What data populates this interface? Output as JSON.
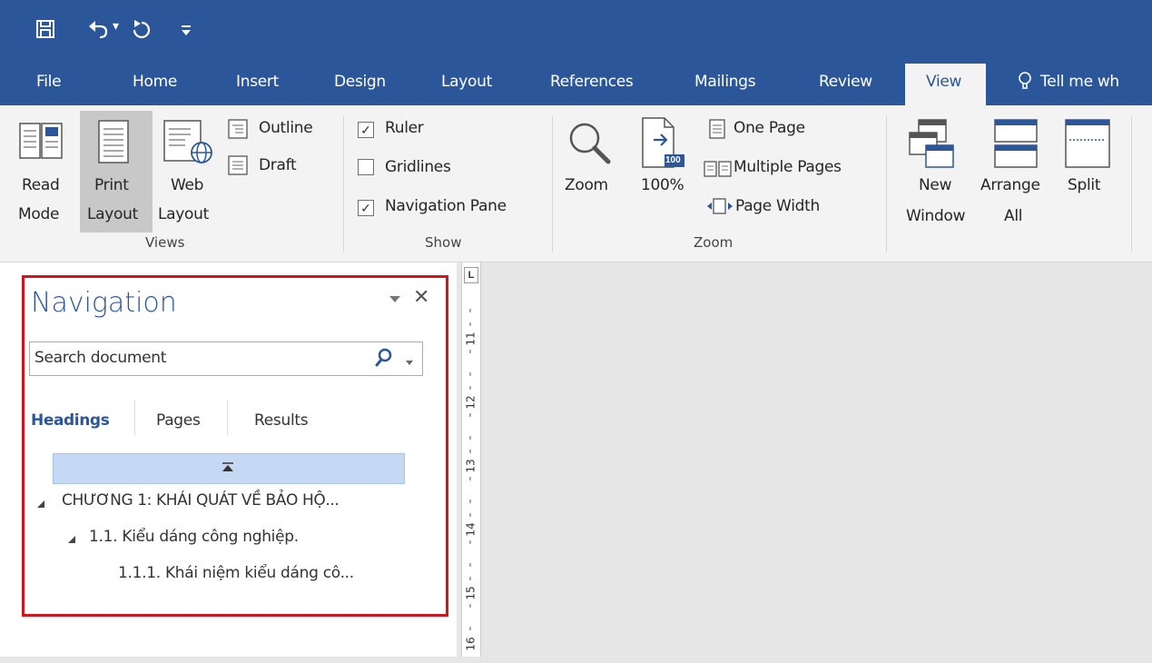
{
  "qat": {
    "save_icon": "floppy-disk",
    "undo_icon": "undo-arrow",
    "undo_dropdown": "▾",
    "repeat_icon": "repeat",
    "customize_icon": "customize"
  },
  "tabs": [
    "File",
    "Home",
    "Insert",
    "Design",
    "Layout",
    "References",
    "Mailings",
    "Review",
    "View"
  ],
  "tell_me": "Tell me wh",
  "ribbon": {
    "views": {
      "read_mode_1": "Read",
      "read_mode_2": "Mode",
      "print_layout_1": "Print",
      "print_layout_2": "Layout",
      "web_layout_1": "Web",
      "web_layout_2": "Layout",
      "outline": "Outline",
      "draft": "Draft",
      "group": "Views"
    },
    "show": {
      "ruler": "Ruler",
      "gridlines": "Gridlines",
      "navigation_pane": "Navigation Pane",
      "group": "Show"
    },
    "zoom": {
      "zoom": "Zoom",
      "hundred": "100%",
      "hundred_badge": "100",
      "one_page": "One Page",
      "multiple_pages": "Multiple Pages",
      "page_width": "Page Width",
      "group": "Zoom"
    },
    "window": {
      "new_window_1": "New",
      "new_window_2": "Window",
      "arrange_all_1": "Arrange",
      "arrange_all_2": "All",
      "split": "Split"
    }
  },
  "navigation": {
    "title": "Navigation",
    "search_placeholder": "Search document",
    "tabs": [
      "Headings",
      "Pages",
      "Results"
    ],
    "headings": [
      {
        "level": 1,
        "text": "CHƯƠNG 1: KHÁI QUÁT VỀ BẢO HỘ..."
      },
      {
        "level": 2,
        "text": "1.1. Kiểu dáng công nghiệp."
      },
      {
        "level": 3,
        "text": "1.1.1. Khái niệm kiểu dáng cô..."
      }
    ]
  },
  "ruler": {
    "corner": "L",
    "numbers": [
      "11",
      "12",
      "13",
      "14",
      "15",
      "16"
    ]
  },
  "colors": {
    "title_bar": "#2b579a",
    "ribbon": "#f3f3f3",
    "highlight_border": "#d2141e",
    "selected_heading": "#c5d8f4"
  }
}
